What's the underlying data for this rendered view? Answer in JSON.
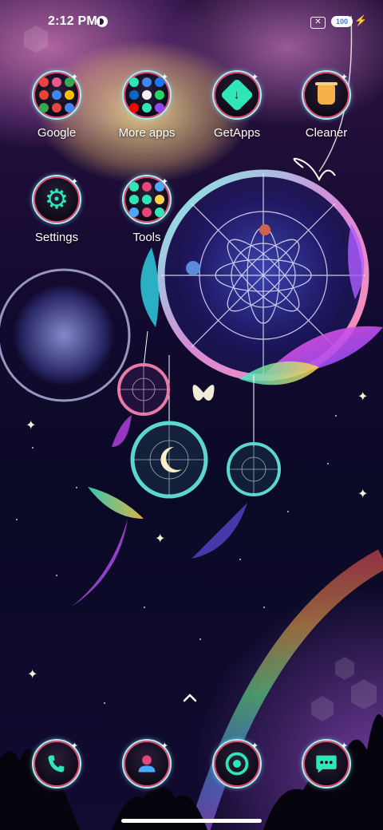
{
  "status_bar": {
    "time": "2:12 PM",
    "battery": "100",
    "icons": [
      "do-not-disturb-icon",
      "no-sim-icon",
      "battery-icon",
      "charging-icon"
    ]
  },
  "home": {
    "apps": [
      {
        "label": "Google",
        "icon": "google-folder-icon"
      },
      {
        "label": "More apps",
        "icon": "more-apps-folder-icon"
      },
      {
        "label": "GetApps",
        "icon": "getapps-icon"
      },
      {
        "label": "Cleaner",
        "icon": "cleaner-icon"
      },
      {
        "label": "Settings",
        "icon": "gear-icon"
      },
      {
        "label": "Tools",
        "icon": "tools-folder-icon"
      }
    ]
  },
  "dock": {
    "apps": [
      {
        "icon": "phone-icon"
      },
      {
        "icon": "contacts-icon"
      },
      {
        "icon": "chrome-icon"
      },
      {
        "icon": "messages-icon"
      }
    ]
  },
  "colors": {
    "icon_ring": "#a8f0e8",
    "icon_accent": "#2ee6b6",
    "icon_inner_ring": "#e8457a"
  }
}
